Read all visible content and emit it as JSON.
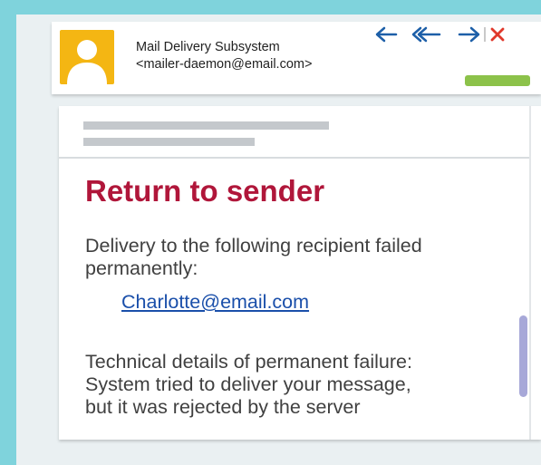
{
  "header": {
    "sender_name": "Mail Delivery Subsystem",
    "sender_email": "<mailer-daemon@email.com>",
    "actions": [
      {
        "icon": "reply-icon",
        "label": "Reply"
      },
      {
        "icon": "reply-all-icon",
        "label": "Reply all"
      },
      {
        "icon": "forward-icon",
        "label": "Forward"
      },
      {
        "icon": "close-icon",
        "label": "Close"
      }
    ]
  },
  "message": {
    "title": "Return to sender",
    "intro": "Delivery to the following recipient failed permanently:",
    "recipient": "Charlotte@email.com",
    "details_line1": "Technical details of permanent failure:",
    "details_line2": "System tried to deliver your message,",
    "details_line3": "but it was rejected by the server"
  },
  "colors": {
    "background": "#7fd3dc",
    "title": "#b0163a",
    "action_arrows": "#1d5fa8",
    "close": "#e0382b",
    "status_bar": "#8cc24a",
    "avatar": "#f4b613"
  }
}
